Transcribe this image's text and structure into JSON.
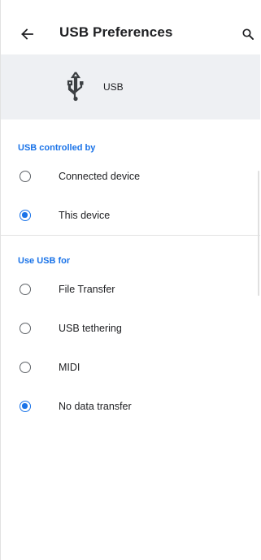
{
  "appbar": {
    "title": "USB Preferences",
    "back_icon": "arrow-back-icon",
    "search_icon": "search-icon"
  },
  "header": {
    "icon": "usb-icon",
    "label": "USB"
  },
  "controlled_by": {
    "title": "USB controlled by",
    "options": [
      {
        "label": "Connected device",
        "selected": false
      },
      {
        "label": "This device",
        "selected": true
      }
    ]
  },
  "use_for": {
    "title": "Use USB for",
    "options": [
      {
        "label": "File Transfer",
        "selected": false
      },
      {
        "label": "USB tethering",
        "selected": false
      },
      {
        "label": "MIDI",
        "selected": false
      },
      {
        "label": "No data transfer",
        "selected": true
      }
    ]
  },
  "colors": {
    "accent": "#1a73e8",
    "header_bg": "#eef0f3"
  }
}
